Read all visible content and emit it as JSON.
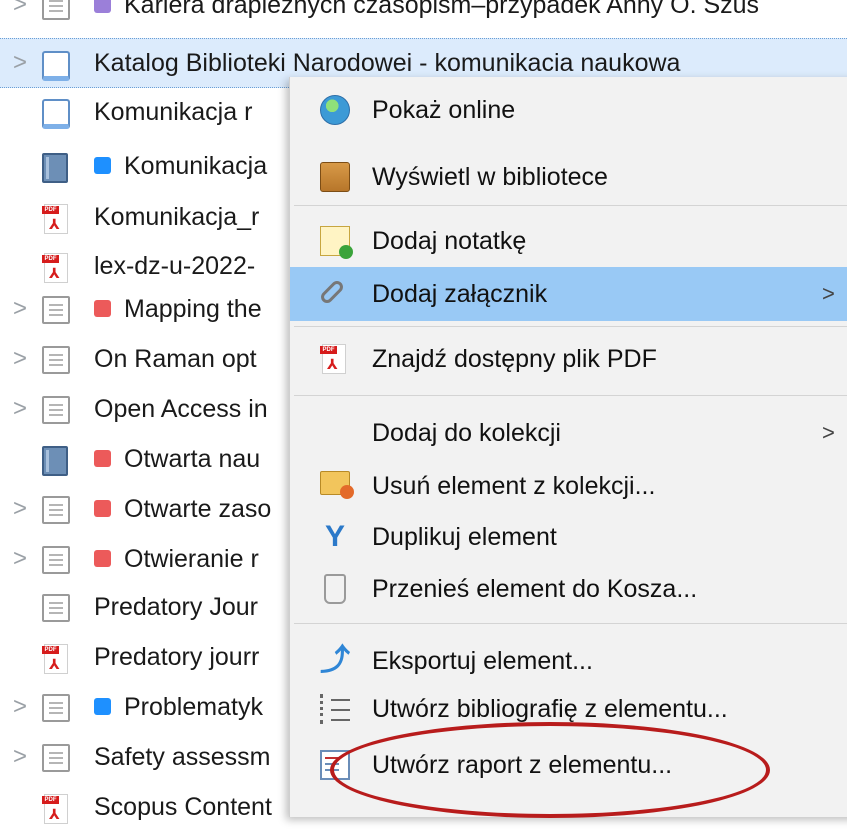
{
  "list": {
    "rows": [
      {
        "twisty": ">",
        "icon": "document-icon",
        "tag": "#9b7fd9",
        "title": "Kariera drapieżnych czasopism–przypadek Anny O. Szus"
      },
      {
        "twisty": ">",
        "icon": "web-page-icon",
        "tag": null,
        "title": "Katalog Biblioteki Narodowei - komunikacia naukowa",
        "selected": true
      },
      {
        "twisty": "",
        "icon": "web-page-icon",
        "tag": null,
        "title": "Komunikacja r"
      },
      {
        "twisty": "",
        "icon": "book-icon",
        "tag": "#1e90ff",
        "title": "Komunikacja"
      },
      {
        "twisty": "",
        "icon": "pdf-icon",
        "tag": null,
        "title": "Komunikacja_r"
      },
      {
        "twisty": "",
        "icon": "pdf-icon",
        "tag": null,
        "title": "lex-dz-u-2022-"
      },
      {
        "twisty": ">",
        "icon": "document-icon",
        "tag": "#ec5a5a",
        "title": "Mapping the"
      },
      {
        "twisty": ">",
        "icon": "document-icon",
        "tag": null,
        "title": "On Raman opt"
      },
      {
        "twisty": ">",
        "icon": "document-icon",
        "tag": null,
        "title": "Open Access in"
      },
      {
        "twisty": "",
        "icon": "book-icon",
        "tag": "#ec5a5a",
        "title": "Otwarta nau"
      },
      {
        "twisty": ">",
        "icon": "document-icon",
        "tag": "#ec5a5a",
        "title": "Otwarte zaso"
      },
      {
        "twisty": ">",
        "icon": "document-icon",
        "tag": "#ec5a5a",
        "title": "Otwieranie r"
      },
      {
        "twisty": "",
        "icon": "document-icon",
        "tag": null,
        "title": "Predatory Jour"
      },
      {
        "twisty": "",
        "icon": "pdf-icon",
        "tag": null,
        "title": "Predatory jourr"
      },
      {
        "twisty": ">",
        "icon": "document-icon",
        "tag": "#1e90ff",
        "title": "Problematyk"
      },
      {
        "twisty": ">",
        "icon": "document-icon",
        "tag": null,
        "title": "Safety assessm"
      },
      {
        "twisty": "",
        "icon": "pdf-icon",
        "tag": null,
        "title": "Scopus Content"
      }
    ]
  },
  "pdf_icon_label": "PDF",
  "context_menu": {
    "items": [
      {
        "label": "Pokaż online",
        "icon": "globe-icon"
      },
      {
        "label": "Wyświetl w bibliotece",
        "icon": "library-box-icon"
      },
      {
        "label": "Dodaj notatkę",
        "icon": "add-note-icon"
      },
      {
        "label": "Dodaj załącznik",
        "icon": "paperclip-icon",
        "submenu": true,
        "highlighted": true
      },
      {
        "label": "Znajdź dostępny plik PDF",
        "icon": "pdf-icon"
      },
      {
        "label": "Dodaj do kolekcji",
        "icon": "none",
        "submenu": true
      },
      {
        "label": "Usuń element z kolekcji...",
        "icon": "folder-remove-icon"
      },
      {
        "label": "Duplikuj element",
        "icon": "duplicate-icon"
      },
      {
        "label": "Przenieś element do Kosza...",
        "icon": "trash-icon"
      },
      {
        "label": "Eksportuj element...",
        "icon": "export-arrow-icon"
      },
      {
        "label": "Utwórz bibliografię z elementu...",
        "icon": "bibliography-list-icon"
      },
      {
        "label": "Utwórz raport z elementu...",
        "icon": "report-icon"
      }
    ],
    "submenu_glyph": ">"
  },
  "annotation": {
    "color": "#b81c1c",
    "target": "Utwórz raport z elementu..."
  }
}
